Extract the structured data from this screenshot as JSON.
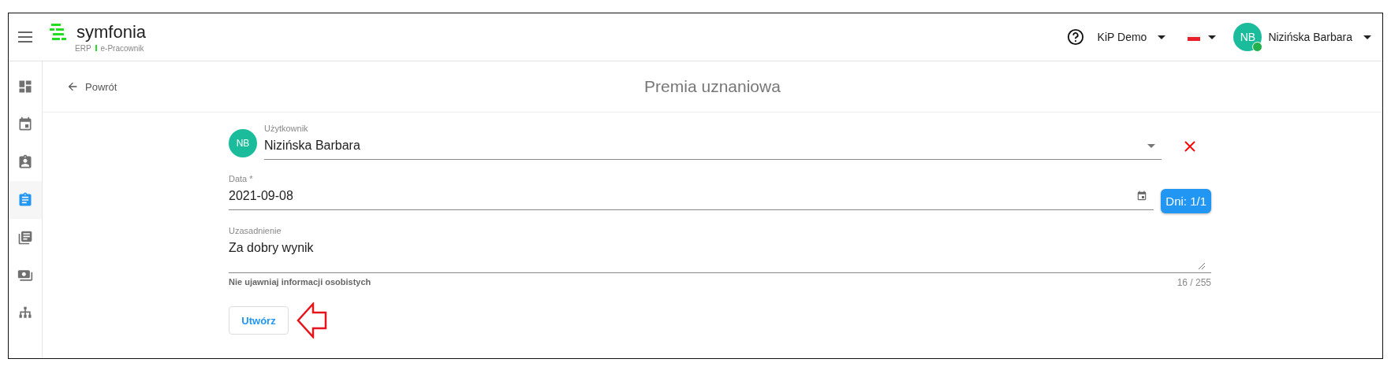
{
  "header": {
    "logo": {
      "name": "symfonia",
      "product": "ERP",
      "module": "e-Pracownik"
    },
    "company": "KiP Demo",
    "user": {
      "initials": "NB",
      "name": "Nizińska Barbara",
      "online": true
    }
  },
  "sidebar": {
    "items": [
      {
        "selected": false
      },
      {
        "selected": false
      },
      {
        "selected": false
      },
      {
        "selected": true
      },
      {
        "selected": false
      },
      {
        "selected": false
      },
      {
        "selected": false
      }
    ]
  },
  "page": {
    "back": "Powrót",
    "title": "Premia uznaniowa"
  },
  "form": {
    "user": {
      "label": "Użytkownik",
      "initials": "NB",
      "value": "Nizińska Barbara"
    },
    "date": {
      "label": "Data *",
      "value": "2021-09-08",
      "days": "Dni: 1/1"
    },
    "reason": {
      "label": "Uzasadnienie",
      "value": "Za dobry wynik",
      "hint": "Nie ujawniaj informacji osobistych",
      "counter": "16 / 255"
    },
    "submit": "Utwórz"
  }
}
